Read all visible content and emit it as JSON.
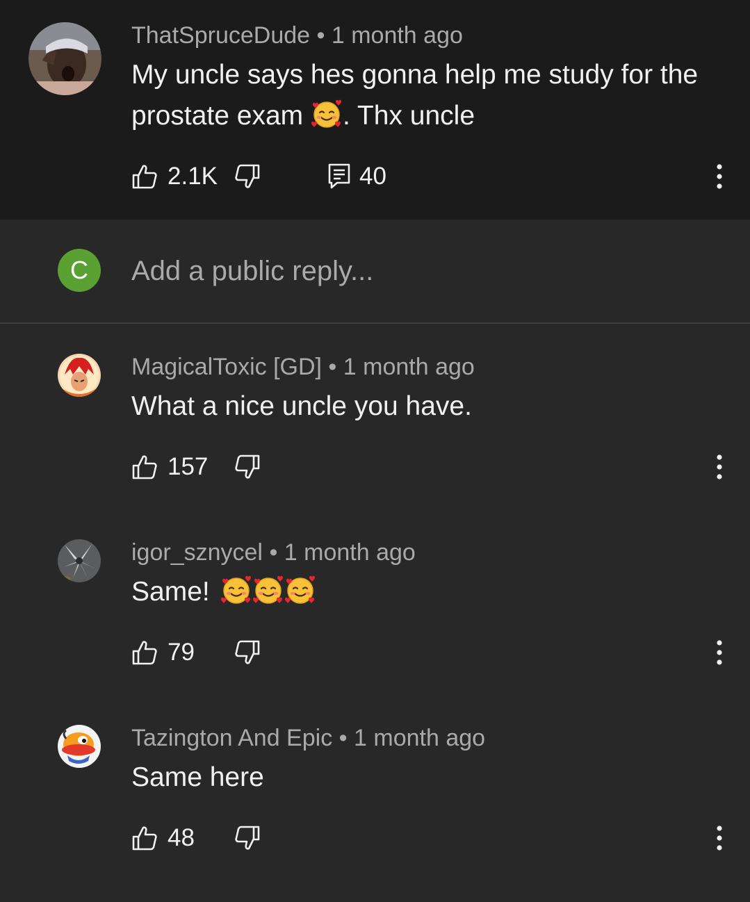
{
  "main_comment": {
    "author": "ThatSpruceDude",
    "age": "1 month ago",
    "text_line1": "My uncle says hes gonna help me study for the",
    "text_line2_a": "prostate exam",
    "text_line2_b": ". Thx uncle",
    "emoji": "smiling-face-with-hearts",
    "likes": "2.1K",
    "replies": "40"
  },
  "reply_box": {
    "avatar_letter": "C",
    "placeholder": "Add a public reply..."
  },
  "replies": [
    {
      "author": "MagicalToxic [GD]",
      "age": "1 month ago",
      "text": "What a nice uncle you have.",
      "likes": "157"
    },
    {
      "author": "igor_sznycel",
      "age": "1 month ago",
      "text": "Same!",
      "emoji_count": 3,
      "likes": "79"
    },
    {
      "author": "Tazington And Epic",
      "age": "1 month ago",
      "text": "Same here",
      "likes": "48"
    }
  ],
  "separator": "•",
  "colors": {
    "background": "#282828",
    "top_background": "#1b1b1b",
    "avatar_c": "#5aa033"
  }
}
